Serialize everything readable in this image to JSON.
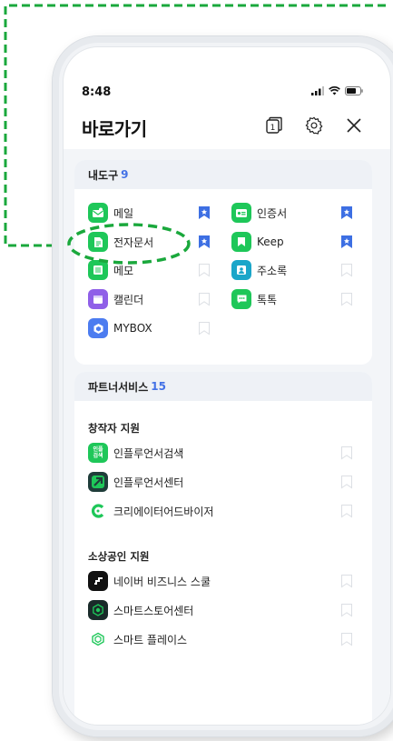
{
  "status_bar": {
    "time": "8:48"
  },
  "header": {
    "title": "바로가기",
    "tab_count": "1"
  },
  "my_tools": {
    "title": "내도구",
    "count": "9",
    "items": [
      {
        "label": "메일",
        "icon": "mail-icon",
        "color": "#1ec759",
        "bookmarked": true
      },
      {
        "label": "인증서",
        "icon": "certificate-icon",
        "color": "#1ec759",
        "bookmarked": true
      },
      {
        "label": "전자문서",
        "icon": "document-icon",
        "color": "#1ec759",
        "bookmarked": true
      },
      {
        "label": "Keep",
        "icon": "keep-icon",
        "color": "#1ec759",
        "bookmarked": true
      },
      {
        "label": "메모",
        "icon": "memo-icon",
        "color": "#1ec759",
        "bookmarked": false
      },
      {
        "label": "주소록",
        "icon": "contacts-icon",
        "color": "#1ba6c9",
        "bookmarked": false
      },
      {
        "label": "캘린더",
        "icon": "calendar-icon",
        "color": "#8f5fe8",
        "bookmarked": false
      },
      {
        "label": "톡톡",
        "icon": "talktalk-icon",
        "color": "#1ec759",
        "bookmarked": false
      },
      {
        "label": "MYBOX",
        "icon": "mybox-icon",
        "color": "#4c7cf0",
        "bookmarked": false
      }
    ]
  },
  "partner_services": {
    "title": "파트너서비스",
    "count": "15",
    "creator_section": "창작자 지원",
    "creator_items": [
      {
        "label": "인플루언서검색",
        "icon": "influencer-search-icon",
        "icon_text": "인플\n검색"
      },
      {
        "label": "인플루언서센터",
        "icon": "influencer-center-icon"
      },
      {
        "label": "크리에이터어드바이저",
        "icon": "creator-advisor-icon"
      }
    ],
    "business_section": "소상공인 지원",
    "business_items": [
      {
        "label": "네이버 비즈니스 스쿨",
        "icon": "business-school-icon"
      },
      {
        "label": "스마트스토어센터",
        "icon": "smartstore-icon"
      },
      {
        "label": "스마트 플레이스",
        "icon": "smart-place-icon"
      }
    ]
  },
  "colors": {
    "accent_blue": "#3d6fe3",
    "highlight_dash": "#1aa83c"
  }
}
